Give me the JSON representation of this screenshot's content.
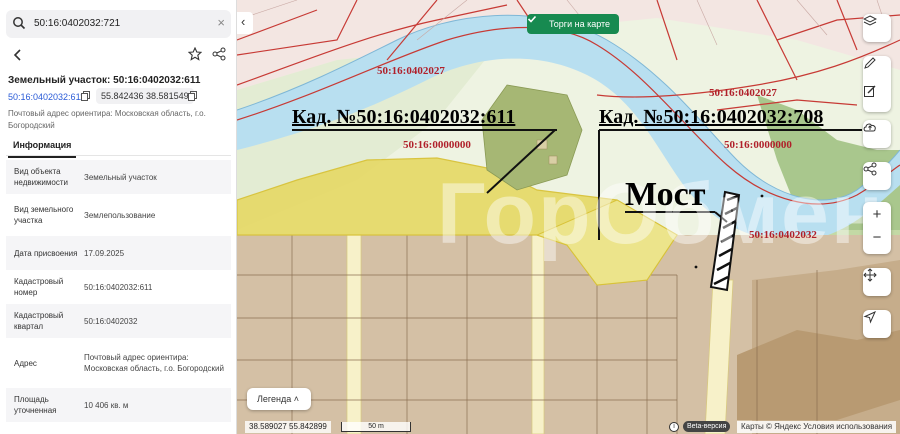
{
  "search": {
    "value": "50:16:0402032:721"
  },
  "card": {
    "title": "Земельный участок: 50:16:0402032:611",
    "cad_link": "50:16:0402032:611",
    "coords": "55.842436 38.581549",
    "address": "Почтовый адрес ориентира: Московская область, г.о. Богородский",
    "tab": "Информация",
    "rows": [
      {
        "k": "Вид объекта недвижимости",
        "v": "Земельный участок"
      },
      {
        "k": "Вид земельного участка",
        "v": "Землепользование"
      },
      {
        "k": "Дата присвоения",
        "v": "17.09.2025"
      },
      {
        "k": "Кадастровый номер",
        "v": "50:16:0402032:611"
      },
      {
        "k": "Кадастровый квартал",
        "v": "50:16:0402032"
      },
      {
        "k": "Адрес",
        "v": "Почтовый адрес ориентира: Московская область, г.о. Богородский"
      },
      {
        "k": "Площадь уточненная",
        "v": "10 406 кв. м"
      }
    ]
  },
  "map": {
    "auction_btn": "Торги на карте",
    "legend": "Легенда",
    "cursor_coords": "38.589027 55.842899",
    "scale": "50 m",
    "info": "i",
    "beta": "Beta-версия",
    "copyright": "Карты © Яндекс   Условия использования",
    "watermark": "ГорОбмен",
    "labels": {
      "q1": "50:16:0402027",
      "q2": "50:16:0402027",
      "q3": "50:16:0000000",
      "q4": "50:16:0000000",
      "q5": "50:16:0402032"
    },
    "annot_left": "Кад. №50:16:0402032:611",
    "annot_right": "Кад. №50:16:0402032:708",
    "annot_bridge": "Мост",
    "zoom_in": "+",
    "zoom_out": "−"
  },
  "colors": {
    "accent": "#178a50",
    "link": "#2a5bd7",
    "cad_label": "#b0202a",
    "river": "#b8dff0",
    "highlight": "#e6da6a"
  }
}
